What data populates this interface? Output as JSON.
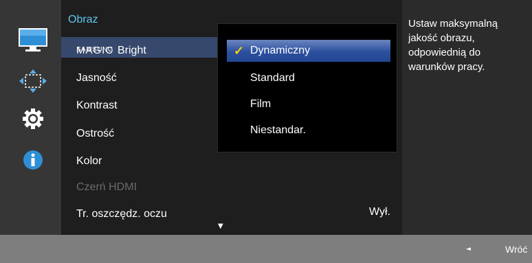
{
  "menu": {
    "title": "Obraz",
    "magic_prefix_top": "SAMSUNG",
    "magic_prefix_bottom": "MAGIC",
    "magic_suffix": "Bright",
    "items": [
      "Jasność",
      "Kontrast",
      "Ostrość",
      "Kolor",
      "Czerń HDMI",
      "Tr. oszczędz. oczu"
    ],
    "eye_saver_value": "Wył.",
    "scroll_indicator": "▼"
  },
  "submenu": {
    "options": [
      "Dynamiczny",
      "Standard",
      "Film",
      "Niestandar."
    ],
    "selected": "Dynamiczny",
    "check_mark": "✓"
  },
  "description": {
    "text_lines": [
      "Ustaw maksymalną",
      "jakość obrazu,",
      "odpowiednią do",
      "warunków pracy."
    ]
  },
  "footer": {
    "back_arrow": "◄",
    "back_label": "Wróć"
  },
  "sidebar": {
    "icons": [
      "monitor-icon",
      "arrows-icon",
      "gear-icon",
      "info-icon"
    ]
  },
  "colors": {
    "accent": "#5ec7ef",
    "selection": "#36486c",
    "submenu_selection": "#2c4f9e",
    "check": "#f3d200"
  }
}
